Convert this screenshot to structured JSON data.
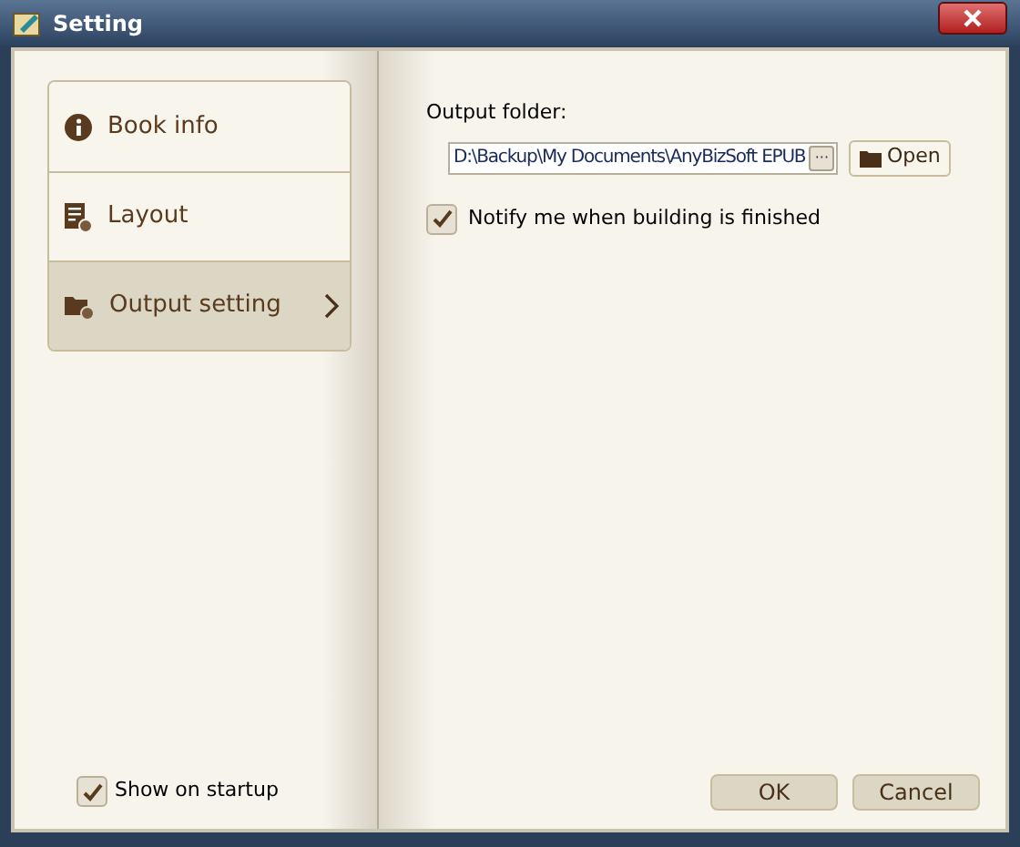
{
  "window": {
    "title": "Setting"
  },
  "nav": [
    {
      "label": "Book info",
      "selected": false
    },
    {
      "label": "Layout",
      "selected": false
    },
    {
      "label": "Output setting",
      "selected": true
    }
  ],
  "show_on_startup": {
    "label": "Show on startup",
    "checked": true
  },
  "output_folder": {
    "label": "Output folder:",
    "value": "D:\\Backup\\My Documents\\AnyBizSoft EPUB",
    "browse": "···",
    "open": "Open"
  },
  "notify": {
    "label": "Notify me when building is finished",
    "checked": true
  },
  "buttons": [
    "OK",
    "Cancel"
  ]
}
